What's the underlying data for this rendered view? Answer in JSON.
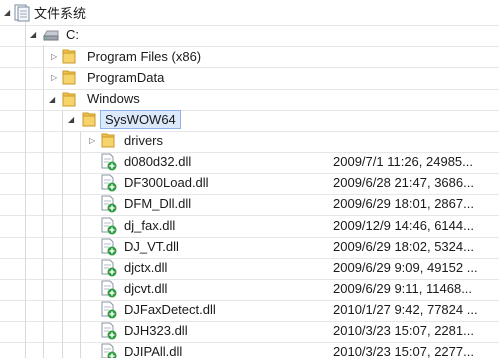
{
  "tree": {
    "root": {
      "label": "文件系统",
      "icon": "filesystem-icon"
    },
    "drive": {
      "label": "C:",
      "icon": "drive-icon"
    },
    "folders": [
      {
        "label": "Program Files (x86)",
        "expanded": false
      },
      {
        "label": "ProgramData",
        "expanded": false
      },
      {
        "label": "Windows",
        "expanded": true
      }
    ],
    "selected_folder": {
      "label": "SysWOW64",
      "expanded": true
    },
    "subfolders": [
      {
        "label": "drivers",
        "expanded": false
      }
    ],
    "files": [
      {
        "name": "d080d32.dll",
        "details": "2009/7/1 11:26, 24985..."
      },
      {
        "name": "DF300Load.dll",
        "details": "2009/6/28 21:47, 3686..."
      },
      {
        "name": "DFM_Dll.dll",
        "details": "2009/6/29 18:01, 2867..."
      },
      {
        "name": "dj_fax.dll",
        "details": "2009/12/9 14:46, 6144..."
      },
      {
        "name": "DJ_VT.dll",
        "details": "2009/6/29 18:02, 5324..."
      },
      {
        "name": "djctx.dll",
        "details": "2009/6/29 9:09, 49152 ..."
      },
      {
        "name": "djcvt.dll",
        "details": "2009/6/29 9:11, 11468..."
      },
      {
        "name": "DJFaxDetect.dll",
        "details": "2010/1/27 9:42, 77824 ..."
      },
      {
        "name": "DJH323.dll",
        "details": "2010/3/23 15:07, 2281..."
      },
      {
        "name": "DJIPAll.dll",
        "details": "2010/3/23 15:07, 2277..."
      }
    ],
    "colors": {
      "folder": "#f2c14b",
      "selection": "#dbe9fb",
      "dll_badge": "#2e9e3e"
    }
  }
}
